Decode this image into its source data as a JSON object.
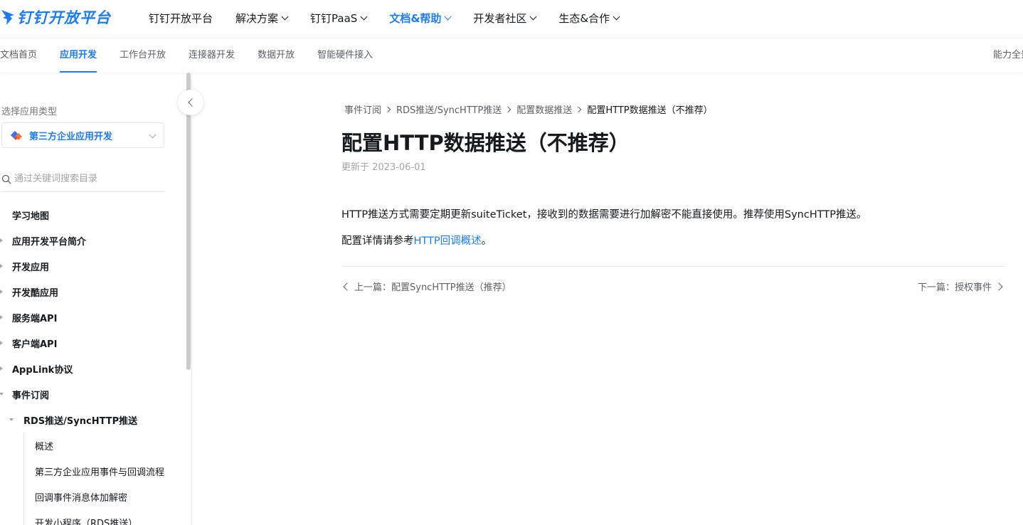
{
  "brand": {
    "name": "钉钉开放平台",
    "color": "#1a7cf9",
    "icon": "dingtalk-logo-icon"
  },
  "topnav": [
    {
      "label": "钉钉开放平台",
      "dropdown": false,
      "active": false
    },
    {
      "label": "解决方案",
      "dropdown": true,
      "active": false
    },
    {
      "label": "钉钉PaaS",
      "dropdown": true,
      "active": false
    },
    {
      "label": "文档&帮助",
      "dropdown": true,
      "active": true
    },
    {
      "label": "开发者社区",
      "dropdown": true,
      "active": false
    },
    {
      "label": "生态&合作",
      "dropdown": true,
      "active": false
    }
  ],
  "subnav": {
    "tabs": [
      "文档首页",
      "应用开发",
      "工作台开放",
      "连接器开发",
      "数据开放",
      "智能硬件接入"
    ],
    "active_index": 1,
    "right_label": "能力全景"
  },
  "sidebar": {
    "select_label": "选择应用类型",
    "selected_app": "第三方企业应用开发",
    "search_placeholder": "通过关键词搜索目录",
    "tree": [
      {
        "label": "学习地图",
        "level": 0,
        "caret": "none"
      },
      {
        "label": "应用开发平台简介",
        "level": 0,
        "caret": "closed"
      },
      {
        "label": "开发应用",
        "level": 0,
        "caret": "closed"
      },
      {
        "label": "开发酷应用",
        "level": 0,
        "caret": "closed"
      },
      {
        "label": "服务端API",
        "level": 0,
        "caret": "closed"
      },
      {
        "label": "客户端API",
        "level": 0,
        "caret": "closed"
      },
      {
        "label": "AppLink协议",
        "level": 0,
        "caret": "closed"
      },
      {
        "label": "事件订阅",
        "level": 0,
        "caret": "open"
      },
      {
        "label": "RDS推送/SyncHTTP推送",
        "level": 1,
        "caret": "open"
      },
      {
        "label": "概述",
        "level": 2,
        "caret": "none"
      },
      {
        "label": "第三方企业应用事件与回调流程",
        "level": 2,
        "caret": "none"
      },
      {
        "label": "回调事件消息体加解密",
        "level": 2,
        "caret": "none"
      },
      {
        "label": "开发小程序（RDS推送）",
        "level": 2,
        "caret": "none"
      }
    ]
  },
  "article": {
    "breadcrumb": [
      "事件订阅",
      "RDS推送/SyncHTTP推送",
      "配置数据推送",
      "配置HTTP数据推送（不推荐）"
    ],
    "title": "配置HTTP数据推送（不推荐）",
    "updated": "更新于 2023-06-01",
    "paragraph1": "HTTP推送方式需要定期更新suiteTicket，接收到的数据需要进行加解密不能直接使用。推荐使用SyncHTTP推送。",
    "paragraph2_prefix": "配置详情请参考",
    "paragraph2_link": "HTTP回调概述",
    "paragraph2_suffix": "。",
    "prev": "上一篇：配置SyncHTTP推送（推荐）",
    "next": "下一篇：授权事件"
  }
}
